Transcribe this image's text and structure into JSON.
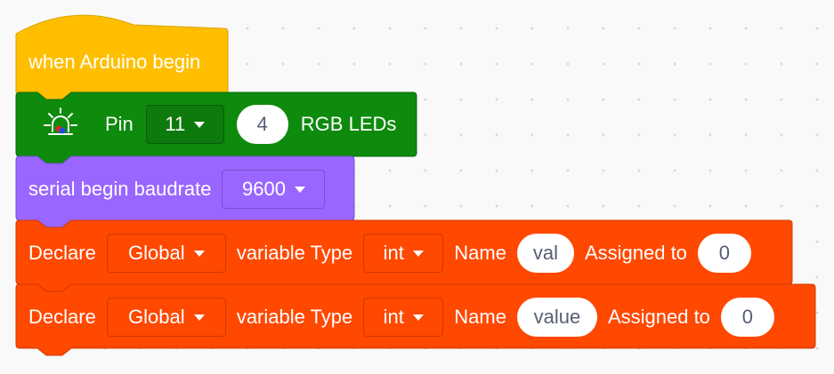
{
  "hat_block": {
    "label": "when Arduino begin",
    "color": "#ffbf00"
  },
  "rgb_block": {
    "icon": "led-icon",
    "pin_label": "Pin",
    "pin_value": "11",
    "count_value": "4",
    "suffix_label": "RGB LEDs",
    "color": "#0e8a0d"
  },
  "serial_block": {
    "label": "serial begin baudrate",
    "baud_value": "9600",
    "color": "#9966ff"
  },
  "declare_blocks": [
    {
      "declare_label": "Declare",
      "scope_value": "Global",
      "type_label": "variable Type",
      "type_value": "int",
      "name_label": "Name",
      "name_value": "val",
      "assign_label": "Assigned to",
      "assign_value": "0"
    },
    {
      "declare_label": "Declare",
      "scope_value": "Global",
      "type_label": "variable Type",
      "type_value": "int",
      "name_label": "Name",
      "name_value": "value",
      "assign_label": "Assigned to",
      "assign_value": "0"
    }
  ],
  "declare_color": "#ff4800"
}
